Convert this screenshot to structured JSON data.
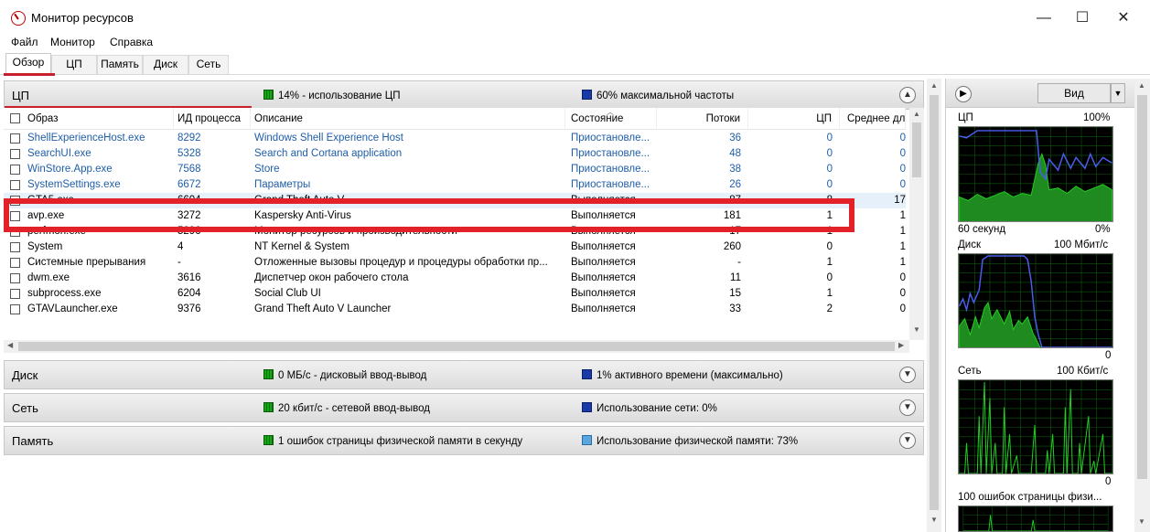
{
  "window": {
    "title": "Монитор ресурсов",
    "minimize_label": "—",
    "maximize_label": "☐",
    "close_label": "✕"
  },
  "menu": [
    "Файл",
    "Монитор",
    "Справка"
  ],
  "tabs": [
    {
      "label": "Обзор",
      "active": true
    },
    {
      "label": "ЦП",
      "active": false
    },
    {
      "label": "Память",
      "active": false
    },
    {
      "label": "Диск",
      "active": false
    },
    {
      "label": "Сеть",
      "active": false
    }
  ],
  "cpu_section": {
    "title": "ЦП",
    "indicator1": "14% - использование ЦП",
    "indicator2": "60% максимальной частоты",
    "columns": [
      "Образ",
      "ИД процесса",
      "Описание",
      "Состояние",
      "Потоки",
      "ЦП",
      "Среднее для"
    ],
    "rows": [
      {
        "image": "ShellExperienceHost.exe",
        "pid": "8292",
        "desc": "Windows Shell Experience Host",
        "state": "Приостановле...",
        "threads": "36",
        "cpu": "0",
        "avg": "0",
        "suspended": true
      },
      {
        "image": "SearchUI.exe",
        "pid": "5328",
        "desc": "Search and Cortana application",
        "state": "Приостановле...",
        "threads": "48",
        "cpu": "0",
        "avg": "0",
        "suspended": true
      },
      {
        "image": "WinStore.App.exe",
        "pid": "7568",
        "desc": "Store",
        "state": "Приостановле...",
        "threads": "38",
        "cpu": "0",
        "avg": "0",
        "suspended": true
      },
      {
        "image": "SystemSettings.exe",
        "pid": "6672",
        "desc": "Параметры",
        "state": "Приостановле...",
        "threads": "26",
        "cpu": "0",
        "avg": "0",
        "suspended": true
      },
      {
        "image": "GTA5.exe",
        "pid": "6604",
        "desc": "Grand Theft Auto V",
        "state": "Выполняется",
        "threads": "87",
        "cpu": "8",
        "avg": "17",
        "selected": true
      },
      {
        "image": "avp.exe",
        "pid": "3272",
        "desc": "Kaspersky Anti-Virus",
        "state": "Выполняется",
        "threads": "181",
        "cpu": "1",
        "avg": "1"
      },
      {
        "image": "perfmon.exe",
        "pid": "5296",
        "desc": "Монитор ресурсов и производительности",
        "state": "Выполняется",
        "threads": "17",
        "cpu": "1",
        "avg": "1"
      },
      {
        "image": "System",
        "pid": "4",
        "desc": "NT Kernel & System",
        "state": "Выполняется",
        "threads": "260",
        "cpu": "0",
        "avg": "1"
      },
      {
        "image": "Системные прерывания",
        "pid": "-",
        "desc": "Отложенные вызовы процедур и процедуры обработки пр...",
        "state": "Выполняется",
        "threads": "-",
        "cpu": "1",
        "avg": "1"
      },
      {
        "image": "dwm.exe",
        "pid": "3616",
        "desc": "Диспетчер окон рабочего стола",
        "state": "Выполняется",
        "threads": "11",
        "cpu": "0",
        "avg": "0"
      },
      {
        "image": "subprocess.exe",
        "pid": "6204",
        "desc": "Social Club UI",
        "state": "Выполняется",
        "threads": "15",
        "cpu": "1",
        "avg": "0"
      },
      {
        "image": "GTAVLauncher.exe",
        "pid": "9376",
        "desc": "Grand Theft Auto V Launcher",
        "state": "Выполняется",
        "threads": "33",
        "cpu": "2",
        "avg": "0"
      }
    ]
  },
  "disk_section": {
    "title": "Диск",
    "indicator1": "0 МБ/с - дисковый ввод-вывод",
    "indicator2": "1% активного времени (максимально)"
  },
  "net_section": {
    "title": "Сеть",
    "indicator1": "20 кбит/с - сетевой ввод-вывод",
    "indicator2": "Использование сети: 0%"
  },
  "mem_section": {
    "title": "Память",
    "indicator1": "1 ошибок страницы физической памяти в секунду",
    "indicator2": "Использование физической памяти: 73%"
  },
  "right_panel": {
    "view_label": "Вид",
    "cpu_graph": {
      "title": "ЦП",
      "max": "100%",
      "footer_left": "60 секунд",
      "footer_right": "0%"
    },
    "disk_graph": {
      "title": "Диск",
      "max": "100 Мбит/с",
      "footer_right": "0"
    },
    "net_graph": {
      "title": "Сеть",
      "max": "100 Кбит/с",
      "footer_right": "0"
    },
    "mem_graph": {
      "title": "100 ошибок страницы физи..."
    }
  },
  "colors": {
    "highlight_red": "#e32129",
    "graph_green": "#22d022",
    "graph_blue": "#4a5ef0",
    "link_blue": "#1f5ea8"
  }
}
